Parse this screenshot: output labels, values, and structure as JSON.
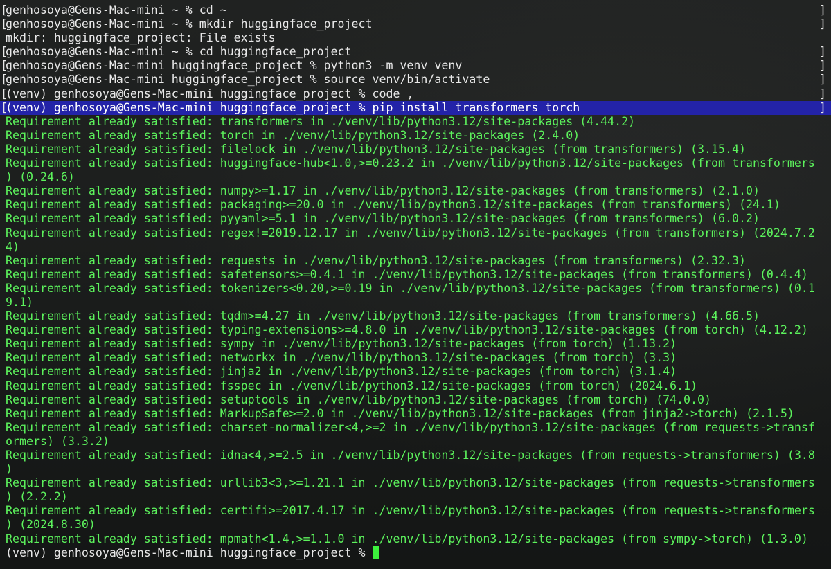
{
  "terminal": {
    "colors": {
      "background": "#1b1d1c",
      "prompt_text": "#e8e8e8",
      "output_text": "#5cf25c",
      "selection": "#2323a8",
      "cursor": "#3cf03c"
    },
    "lines": [
      {
        "kind": "prompt",
        "mark": true,
        "text": "genhosoya@Gens-Mac-mini ~ % cd ~"
      },
      {
        "kind": "prompt",
        "mark": true,
        "text": "genhosoya@Gens-Mac-mini ~ % mkdir huggingface_project"
      },
      {
        "kind": "prompt",
        "mark": false,
        "text": "mkdir: huggingface_project: File exists"
      },
      {
        "kind": "prompt",
        "mark": true,
        "text": "genhosoya@Gens-Mac-mini ~ % cd huggingface_project"
      },
      {
        "kind": "prompt",
        "mark": true,
        "text": "genhosoya@Gens-Mac-mini huggingface_project % python3 -m venv venv"
      },
      {
        "kind": "prompt",
        "mark": true,
        "text": "genhosoya@Gens-Mac-mini huggingface_project % source venv/bin/activate"
      },
      {
        "kind": "prompt",
        "mark": true,
        "text": "(venv) genhosoya@Gens-Mac-mini huggingface_project % code ,"
      },
      {
        "kind": "highlight",
        "mark": true,
        "text": "(venv) genhosoya@Gens-Mac-mini huggingface_project % pip install transformers torch"
      },
      {
        "kind": "output",
        "mark": false,
        "text": "Requirement already satisfied: transformers in ./venv/lib/python3.12/site-packages (4.44.2)"
      },
      {
        "kind": "output",
        "mark": false,
        "text": "Requirement already satisfied: torch in ./venv/lib/python3.12/site-packages (2.4.0)"
      },
      {
        "kind": "output",
        "mark": false,
        "text": "Requirement already satisfied: filelock in ./venv/lib/python3.12/site-packages (from transformers) (3.15.4)"
      },
      {
        "kind": "output",
        "mark": false,
        "text": "Requirement already satisfied: huggingface-hub<1.0,>=0.23.2 in ./venv/lib/python3.12/site-packages (from transformers"
      },
      {
        "kind": "output",
        "mark": false,
        "text": ") (0.24.6)"
      },
      {
        "kind": "output",
        "mark": false,
        "text": "Requirement already satisfied: numpy>=1.17 in ./venv/lib/python3.12/site-packages (from transformers) (2.1.0)"
      },
      {
        "kind": "output",
        "mark": false,
        "text": "Requirement already satisfied: packaging>=20.0 in ./venv/lib/python3.12/site-packages (from transformers) (24.1)"
      },
      {
        "kind": "output",
        "mark": false,
        "text": "Requirement already satisfied: pyyaml>=5.1 in ./venv/lib/python3.12/site-packages (from transformers) (6.0.2)"
      },
      {
        "kind": "output",
        "mark": false,
        "text": "Requirement already satisfied: regex!=2019.12.17 in ./venv/lib/python3.12/site-packages (from transformers) (2024.7.2"
      },
      {
        "kind": "output",
        "mark": false,
        "text": "4)"
      },
      {
        "kind": "output",
        "mark": false,
        "text": "Requirement already satisfied: requests in ./venv/lib/python3.12/site-packages (from transformers) (2.32.3)"
      },
      {
        "kind": "output",
        "mark": false,
        "text": "Requirement already satisfied: safetensors>=0.4.1 in ./venv/lib/python3.12/site-packages (from transformers) (0.4.4)"
      },
      {
        "kind": "output",
        "mark": false,
        "text": "Requirement already satisfied: tokenizers<0.20,>=0.19 in ./venv/lib/python3.12/site-packages (from transformers) (0.1"
      },
      {
        "kind": "output",
        "mark": false,
        "text": "9.1)"
      },
      {
        "kind": "output",
        "mark": false,
        "text": "Requirement already satisfied: tqdm>=4.27 in ./venv/lib/python3.12/site-packages (from transformers) (4.66.5)"
      },
      {
        "kind": "output",
        "mark": false,
        "text": "Requirement already satisfied: typing-extensions>=4.8.0 in ./venv/lib/python3.12/site-packages (from torch) (4.12.2)"
      },
      {
        "kind": "output",
        "mark": false,
        "text": "Requirement already satisfied: sympy in ./venv/lib/python3.12/site-packages (from torch) (1.13.2)"
      },
      {
        "kind": "output",
        "mark": false,
        "text": "Requirement already satisfied: networkx in ./venv/lib/python3.12/site-packages (from torch) (3.3)"
      },
      {
        "kind": "output",
        "mark": false,
        "text": "Requirement already satisfied: jinja2 in ./venv/lib/python3.12/site-packages (from torch) (3.1.4)"
      },
      {
        "kind": "output",
        "mark": false,
        "text": "Requirement already satisfied: fsspec in ./venv/lib/python3.12/site-packages (from torch) (2024.6.1)"
      },
      {
        "kind": "output",
        "mark": false,
        "text": "Requirement already satisfied: setuptools in ./venv/lib/python3.12/site-packages (from torch) (74.0.0)"
      },
      {
        "kind": "output",
        "mark": false,
        "text": "Requirement already satisfied: MarkupSafe>=2.0 in ./venv/lib/python3.12/site-packages (from jinja2->torch) (2.1.5)"
      },
      {
        "kind": "output",
        "mark": false,
        "text": "Requirement already satisfied: charset-normalizer<4,>=2 in ./venv/lib/python3.12/site-packages (from requests->transf"
      },
      {
        "kind": "output",
        "mark": false,
        "text": "ormers) (3.3.2)"
      },
      {
        "kind": "output",
        "mark": false,
        "text": "Requirement already satisfied: idna<4,>=2.5 in ./venv/lib/python3.12/site-packages (from requests->transformers) (3.8"
      },
      {
        "kind": "output",
        "mark": false,
        "text": ")"
      },
      {
        "kind": "output",
        "mark": false,
        "text": "Requirement already satisfied: urllib3<3,>=1.21.1 in ./venv/lib/python3.12/site-packages (from requests->transformers"
      },
      {
        "kind": "output",
        "mark": false,
        "text": ") (2.2.2)"
      },
      {
        "kind": "output",
        "mark": false,
        "text": "Requirement already satisfied: certifi>=2017.4.17 in ./venv/lib/python3.12/site-packages (from requests->transformers"
      },
      {
        "kind": "output",
        "mark": false,
        "text": ") (2024.8.30)"
      },
      {
        "kind": "output",
        "mark": false,
        "text": "Requirement already satisfied: mpmath<1.4,>=1.1.0 in ./venv/lib/python3.12/site-packages (from sympy->torch) (1.3.0)"
      },
      {
        "kind": "prompt",
        "mark": false,
        "cursor": true,
        "text": "(venv) genhosoya@Gens-Mac-mini huggingface_project % "
      }
    ]
  }
}
